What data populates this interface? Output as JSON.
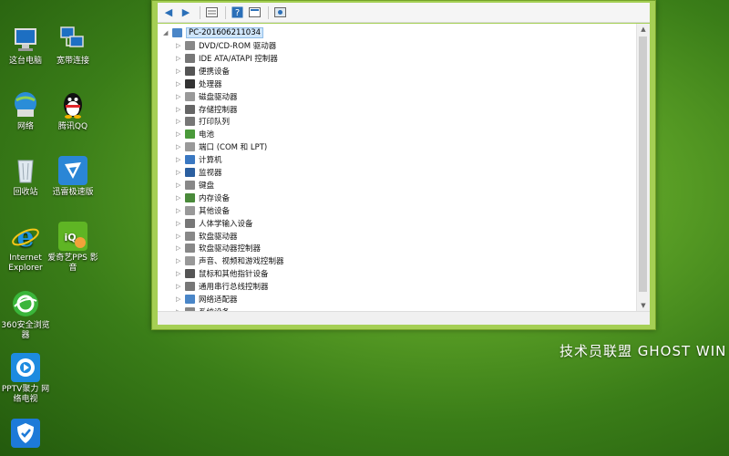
{
  "desktop": {
    "icons": [
      {
        "label": "这台电脑",
        "icon": "computer-icon"
      },
      {
        "label": "宽带连接",
        "icon": "broadband-icon"
      },
      {
        "label": "网络",
        "icon": "network-icon"
      },
      {
        "label": "腾讯QQ",
        "icon": "qq-icon"
      },
      {
        "label": "回收站",
        "icon": "recycle-bin-icon"
      },
      {
        "label": "迅雷极速版",
        "icon": "xunlei-icon"
      },
      {
        "label": "Internet Explorer",
        "icon": "ie-icon"
      },
      {
        "label": "爱奇艺PPS 影音",
        "icon": "iqiyi-icon"
      },
      {
        "label": "360安全浏览器",
        "icon": "360-browser-icon"
      },
      {
        "label": "PPTV聚力 网络电视",
        "icon": "pptv-icon"
      },
      {
        "label": "",
        "icon": "shield-icon"
      }
    ]
  },
  "watermark": "技术员联盟  GHOST  WIN",
  "device_manager": {
    "root": "PC-201606211034",
    "items": [
      "DVD/CD-ROM 驱动器",
      "IDE ATA/ATAPI 控制器",
      "便携设备",
      "处理器",
      "磁盘驱动器",
      "存储控制器",
      "打印队列",
      "电池",
      "端口 (COM 和 LPT)",
      "计算机",
      "监视器",
      "键盘",
      "内存设备",
      "其他设备",
      "人体学输入设备",
      "软盘驱动器",
      "软盘驱动器控制器",
      "声音、视频和游戏控制器",
      "鼠标和其他指针设备",
      "通用串行总线控制器",
      "网络适配器",
      "系统设备"
    ]
  },
  "colors": {
    "window_frame": "#a5cf54",
    "selection": "#cfe5fa",
    "toolbar_icon": "#2b6fb8"
  }
}
